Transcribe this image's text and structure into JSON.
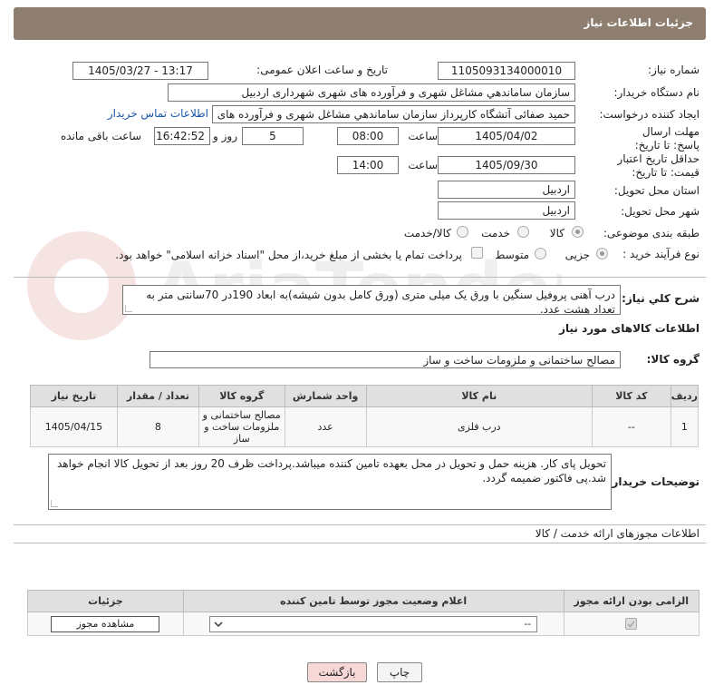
{
  "header": {
    "title": "جزئیات اطلاعات نیاز"
  },
  "fields": {
    "need_number_label": "شماره نیاز:",
    "need_number": "1105093134000010",
    "announce_label": "تاریخ و ساعت اعلان عمومی:",
    "announce_value": "1405/03/27 - 13:17",
    "buyer_org_label": "نام دستگاه خریدار:",
    "buyer_org": "سازمان ساماندهي مشاغل شهری و فرآورده های شهری شهرداری اردبیل",
    "creator_label": "ایجاد کننده درخواست:",
    "creator": "حمید صفائی آتشگاه کارپرداز سازمان ساماندهي مشاغل شهری و فرآورده های",
    "contact_link": "اطلاعات تماس خریدار",
    "deadline_label": "مهلت ارسال پاسخ: تا تاریخ:",
    "deadline_date": "1405/04/02",
    "time_word": "ساعت",
    "deadline_time": "08:00",
    "days_value": "5",
    "days_word": "روز و",
    "remaining_time": "16:42:52",
    "remaining_word": "ساعت باقی مانده",
    "min_price_label": "حداقل تاریخ اعتبار قیمت: تا تاریخ:",
    "min_price_date": "1405/09/30",
    "min_price_time": "14:00",
    "province_label": "استان محل تحویل:",
    "province": "اردبیل",
    "city_label": "شهر محل تحویل:",
    "city": "اردبیل",
    "category_label": "طبقه بندی موضوعی:",
    "category_options": [
      "کالا",
      "خدمت",
      "کالا/خدمت"
    ],
    "process_label": "نوع فرآیند خرید :",
    "process_options": [
      "جزیی",
      "متوسط"
    ],
    "payment_note": "پرداخت تمام یا بخشی از مبلغ خرید،از محل \"اسناد خزانه اسلامی\" خواهد بود."
  },
  "description": {
    "label": "شرح كلي نياز:",
    "text": "درب آهنی پروفیل سنگین با ورق یک میلی متری (ورق کامل بدون شیشه)به ابعاد 190در 70سانتی متر به تعداد هشت عدد."
  },
  "goods": {
    "section_title": "اطلاعات کالاهای مورد نیاز",
    "group_label": "گروه کالا:",
    "group_value": "مصالح ساختمانی و ملزومات ساخت و ساز",
    "columns": [
      "ردیف",
      "کد کالا",
      "نام کالا",
      "واحد شمارش",
      "گروه کالا",
      "تعداد / مقدار",
      "تاریخ نیاز"
    ],
    "rows": [
      {
        "row": "1",
        "code": "--",
        "name": "درب فلزی",
        "unit": "عدد",
        "group": "مصالح ساختمانی و ملزومات ساخت و ساز",
        "qty": "8",
        "date": "1405/04/15"
      }
    ]
  },
  "buyer_notes": {
    "label": "توضیحات خریدار:",
    "text": "تحویل پای کار. هزینه حمل و تحویل در محل بعهده تامین کننده میباشد.پرداخت ظرف 20 روز بعد از تحویل کالا انجام خواهد شد.پی فاکتور ضمیمه گردد."
  },
  "permits": {
    "section_title": "اطلاعات مجوزهای ارائه خدمت / کالا",
    "columns": [
      "الزامی بودن ارائه مجوز",
      "اعلام وضعیت مجوز توسط تامین کننده",
      "جزئیات"
    ],
    "select_value": "--",
    "view_button": "مشاهده مجوز"
  },
  "footer": {
    "print": "چاپ",
    "back": "بازگشت"
  },
  "watermark": "AriaTender.net",
  "colors": {
    "title_bar": "#8d7e6f",
    "link": "#1a58a8",
    "back_button": "#f8d7d7"
  }
}
